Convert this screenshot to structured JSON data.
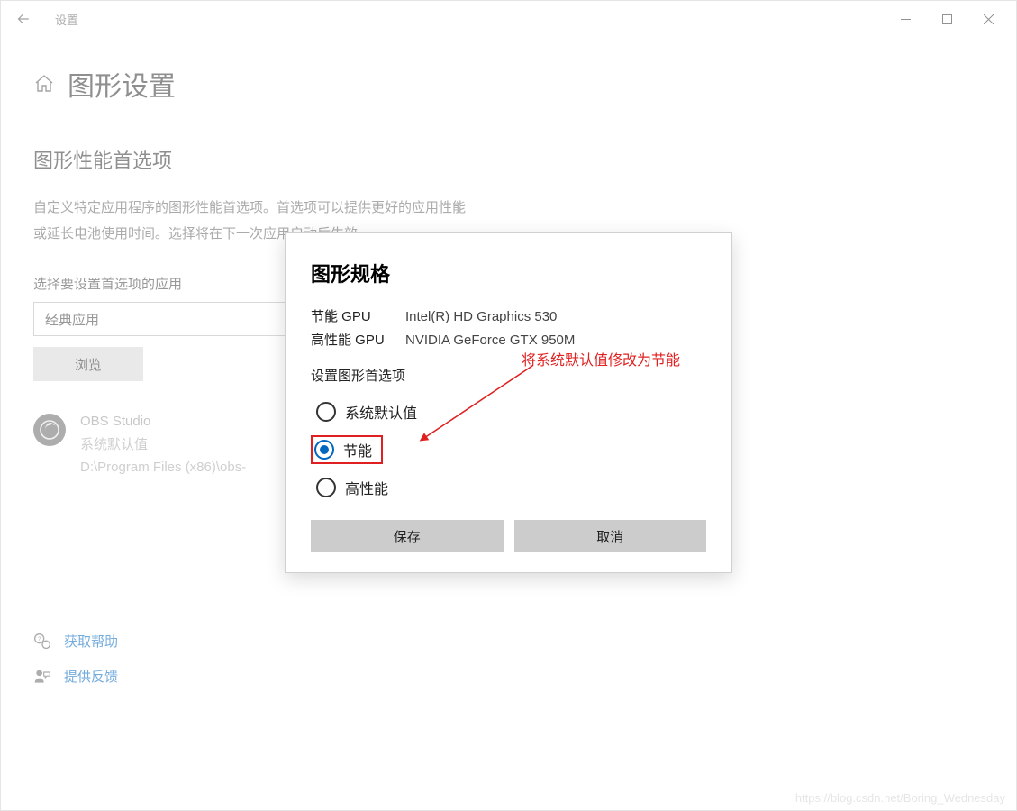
{
  "titlebar": {
    "title": "设置"
  },
  "page": {
    "title": "图形设置",
    "section_title": "图形性能首选项",
    "description_line1": "自定义特定应用程序的图形性能首选项。首选项可以提供更好的应用性能",
    "description_line2": "或延长电池使用时间。选择将在下一次应用启动后生效。",
    "select_label": "选择要设置首选项的应用",
    "dropdown_value": "经典应用",
    "browse_label": "浏览"
  },
  "app": {
    "name": "OBS Studio",
    "pref": "系统默认值",
    "path": "D:\\Program Files (x86)\\obs-"
  },
  "modal": {
    "title": "图形规格",
    "eco_gpu_label": "节能 GPU",
    "eco_gpu_value": "Intel(R) HD Graphics 530",
    "perf_gpu_label": "高性能 GPU",
    "perf_gpu_value": "NVIDIA GeForce GTX 950M",
    "subheading": "设置图形首选项",
    "radio_default": "系统默认值",
    "radio_eco": "节能",
    "radio_perf": "高性能",
    "save": "保存",
    "cancel": "取消"
  },
  "annotation": {
    "text": "将系统默认值修改为节能"
  },
  "footer": {
    "help": "获取帮助",
    "feedback": "提供反馈"
  },
  "watermark": "https://blog.csdn.net/Boring_Wednesday"
}
